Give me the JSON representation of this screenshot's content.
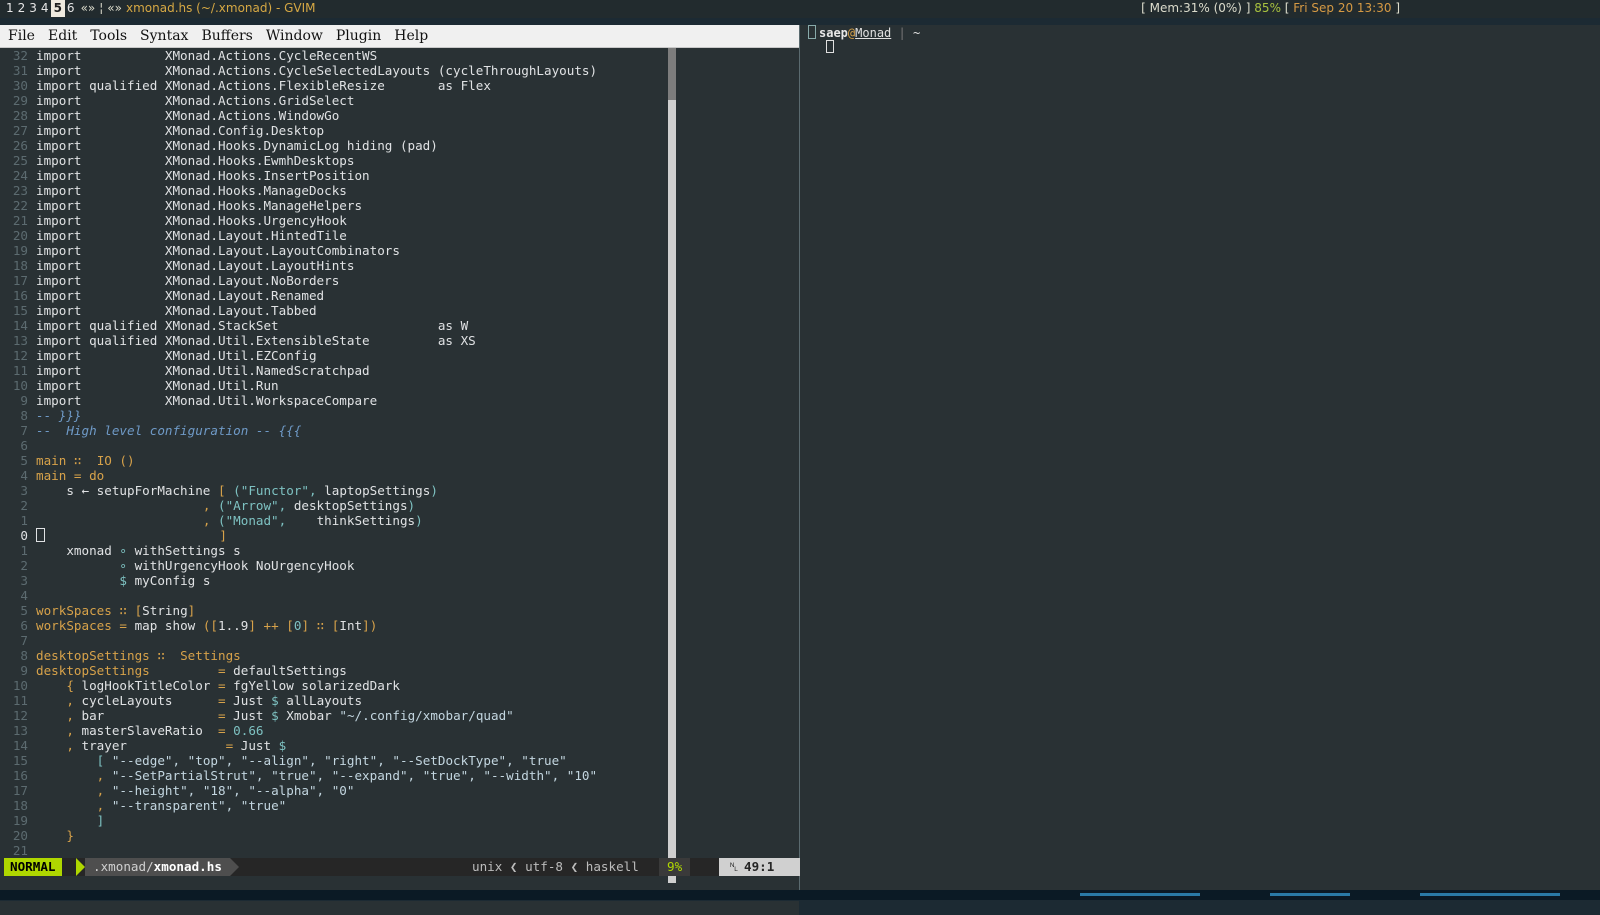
{
  "topbar": {
    "workspaces": [
      {
        "label": "1",
        "current": false
      },
      {
        "label": "2",
        "current": false
      },
      {
        "label": "3",
        "current": false
      },
      {
        "label": "4",
        "current": false
      },
      {
        "label": "5",
        "current": true
      },
      {
        "label": "6",
        "current": false
      }
    ],
    "layout_marker": "«»",
    "separator": "¦",
    "layout_marker2": "«»",
    "window_title": "xmonad.hs (~/.xmonad) - GVIM",
    "mem_open": "[ Mem:",
    "mem_value": "31% (0%)",
    "mem_close": " ] ",
    "battery": "85%",
    "date_open": " [ ",
    "date": "Fri Sep 20 13:30",
    "date_close": " ]"
  },
  "menubar": [
    "File",
    "Edit",
    "Tools",
    "Syntax",
    "Buffers",
    "Window",
    "Plugin",
    "Help"
  ],
  "editor": {
    "lines": [
      {
        "n": "32",
        "t": [
          [
            "kw",
            "import           XMonad.Actions.CycleRecentWS"
          ]
        ]
      },
      {
        "n": "31",
        "t": [
          [
            "kw",
            "import           XMonad.Actions.CycleSelectedLayouts (cycleThroughLayouts)"
          ]
        ]
      },
      {
        "n": "30",
        "t": [
          [
            "kw",
            "import qualified XMonad.Actions.FlexibleResize       as Flex"
          ]
        ]
      },
      {
        "n": "29",
        "t": [
          [
            "kw",
            "import           XMonad.Actions.GridSelect"
          ]
        ]
      },
      {
        "n": "28",
        "t": [
          [
            "kw",
            "import           XMonad.Actions.WindowGo"
          ]
        ]
      },
      {
        "n": "27",
        "t": [
          [
            "kw",
            "import           XMonad.Config.Desktop"
          ]
        ]
      },
      {
        "n": "26",
        "t": [
          [
            "kw",
            "import           XMonad.Hooks.DynamicLog hiding (pad)"
          ]
        ]
      },
      {
        "n": "25",
        "t": [
          [
            "kw",
            "import           XMonad.Hooks.EwmhDesktops"
          ]
        ]
      },
      {
        "n": "24",
        "t": [
          [
            "kw",
            "import           XMonad.Hooks.InsertPosition"
          ]
        ]
      },
      {
        "n": "23",
        "t": [
          [
            "kw",
            "import           XMonad.Hooks.ManageDocks"
          ]
        ]
      },
      {
        "n": "22",
        "t": [
          [
            "kw",
            "import           XMonad.Hooks.ManageHelpers"
          ]
        ]
      },
      {
        "n": "21",
        "t": [
          [
            "kw",
            "import           XMonad.Hooks.UrgencyHook"
          ]
        ]
      },
      {
        "n": "20",
        "t": [
          [
            "kw",
            "import           XMonad.Layout.HintedTile"
          ]
        ]
      },
      {
        "n": "19",
        "t": [
          [
            "kw",
            "import           XMonad.Layout.LayoutCombinators"
          ]
        ]
      },
      {
        "n": "18",
        "t": [
          [
            "kw",
            "import           XMonad.Layout.LayoutHints"
          ]
        ]
      },
      {
        "n": "17",
        "t": [
          [
            "kw",
            "import           XMonad.Layout.NoBorders"
          ]
        ]
      },
      {
        "n": "16",
        "t": [
          [
            "kw",
            "import           XMonad.Layout.Renamed"
          ]
        ]
      },
      {
        "n": "15",
        "t": [
          [
            "kw",
            "import           XMonad.Layout.Tabbed"
          ]
        ]
      },
      {
        "n": "14",
        "t": [
          [
            "kw",
            "import qualified XMonad.StackSet                     as W"
          ]
        ]
      },
      {
        "n": "13",
        "t": [
          [
            "kw",
            "import qualified XMonad.Util.ExtensibleState         as XS"
          ]
        ]
      },
      {
        "n": "12",
        "t": [
          [
            "kw",
            "import           XMonad.Util.EZConfig"
          ]
        ]
      },
      {
        "n": "11",
        "t": [
          [
            "kw",
            "import           XMonad.Util.NamedScratchpad"
          ]
        ]
      },
      {
        "n": "10",
        "t": [
          [
            "kw",
            "import           XMonad.Util.Run"
          ]
        ]
      },
      {
        "n": "9",
        "t": [
          [
            "kw",
            "import           XMonad.Util.WorkspaceCompare"
          ]
        ]
      },
      {
        "n": "8",
        "t": [
          [
            "cm",
            "-- }}}"
          ]
        ]
      },
      {
        "n": "7",
        "t": [
          [
            "cm",
            "--  High level configuration -- {{{"
          ]
        ]
      },
      {
        "n": "6",
        "t": []
      },
      {
        "n": "5",
        "t": [
          [
            "fn",
            "main"
          ],
          [
            "op",
            " ∷  "
          ],
          [
            "ty",
            "IO ()"
          ]
        ]
      },
      {
        "n": "4",
        "t": [
          [
            "fn",
            "main"
          ],
          [
            "op",
            " = "
          ],
          [
            "fn",
            "do"
          ]
        ]
      },
      {
        "n": "3",
        "t": [
          [
            "kw",
            "    s ← setupForMachine "
          ],
          [
            "op",
            "[ "
          ],
          [
            "tl",
            "(\"Functor\", "
          ],
          [
            "kw",
            "laptopSettings"
          ],
          [
            "tl",
            ")"
          ]
        ]
      },
      {
        "n": "2",
        "t": [
          [
            "kw",
            "                      "
          ],
          [
            "op",
            ", "
          ],
          [
            "tl",
            "(\"Arrow\", "
          ],
          [
            "kw",
            "desktopSettings"
          ],
          [
            "tl",
            ")"
          ]
        ]
      },
      {
        "n": "1",
        "t": [
          [
            "kw",
            "                      "
          ],
          [
            "op",
            ", "
          ],
          [
            "tl",
            "(\"Monad\",    "
          ],
          [
            "kw",
            "thinkSettings"
          ],
          [
            "tl",
            ")"
          ]
        ]
      },
      {
        "n": "0",
        "cur": true,
        "t": [
          [
            "cursor",
            ""
          ],
          [
            "kw",
            "                       "
          ],
          [
            "op",
            "]"
          ]
        ]
      },
      {
        "n": "1",
        "t": [
          [
            "kw",
            "    xmonad "
          ],
          [
            "tl",
            "∘"
          ],
          [
            "kw",
            " withSettings s"
          ]
        ]
      },
      {
        "n": "2",
        "t": [
          [
            "kw",
            "           "
          ],
          [
            "tl",
            "∘"
          ],
          [
            "kw",
            " withUrgencyHook NoUrgencyHook"
          ]
        ]
      },
      {
        "n": "3",
        "t": [
          [
            "kw",
            "           "
          ],
          [
            "tl",
            "$"
          ],
          [
            "kw",
            " myConfig s"
          ]
        ]
      },
      {
        "n": "4",
        "t": []
      },
      {
        "n": "5",
        "t": [
          [
            "fn",
            "workSpaces"
          ],
          [
            "op",
            " ∷ "
          ],
          [
            "ty",
            "["
          ],
          [
            "kw",
            "String"
          ],
          [
            "ty",
            "]"
          ]
        ]
      },
      {
        "n": "6",
        "t": [
          [
            "fn",
            "workSpaces"
          ],
          [
            "op",
            " = "
          ],
          [
            "kw",
            "map show "
          ],
          [
            "ty",
            "(["
          ],
          [
            "kw",
            "1..9"
          ],
          [
            "ty",
            "] "
          ],
          [
            "op",
            "++ "
          ],
          [
            "ty",
            "["
          ],
          [
            "nu",
            "0"
          ],
          [
            "ty",
            "] "
          ],
          [
            "op",
            "∷ "
          ],
          [
            "ty",
            "["
          ],
          [
            "kw",
            "Int"
          ],
          [
            "ty",
            "])"
          ]
        ]
      },
      {
        "n": "7",
        "t": []
      },
      {
        "n": "8",
        "t": [
          [
            "fn",
            "desktopSettings"
          ],
          [
            "op",
            " ∷  "
          ],
          [
            "ty",
            "Settings"
          ]
        ]
      },
      {
        "n": "9",
        "t": [
          [
            "fn",
            "desktopSettings"
          ],
          [
            "kw",
            "         "
          ],
          [
            "op",
            "= "
          ],
          [
            "kw",
            "defaultSettings"
          ]
        ]
      },
      {
        "n": "10",
        "t": [
          [
            "kw",
            "    "
          ],
          [
            "op",
            "{ "
          ],
          [
            "kw",
            "logHookTitleColor "
          ],
          [
            "op",
            "= "
          ],
          [
            "kw",
            "fgYellow solarizedDark"
          ]
        ]
      },
      {
        "n": "11",
        "t": [
          [
            "kw",
            "    "
          ],
          [
            "op",
            ", "
          ],
          [
            "kw",
            "cycleLayouts      "
          ],
          [
            "op",
            "= "
          ],
          [
            "kw",
            "Just "
          ],
          [
            "tl",
            "$"
          ],
          [
            "kw",
            " allLayouts"
          ]
        ]
      },
      {
        "n": "12",
        "t": [
          [
            "kw",
            "    "
          ],
          [
            "op",
            ", "
          ],
          [
            "kw",
            "bar               "
          ],
          [
            "op",
            "= "
          ],
          [
            "kw",
            "Just "
          ],
          [
            "tl",
            "$"
          ],
          [
            "kw",
            " Xmobar "
          ],
          [
            "st",
            "\"~/.config/xmobar/quad\""
          ]
        ]
      },
      {
        "n": "13",
        "t": [
          [
            "kw",
            "    "
          ],
          [
            "op",
            ", "
          ],
          [
            "kw",
            "masterSlaveRatio  "
          ],
          [
            "op",
            "= "
          ],
          [
            "nu",
            "0.66"
          ]
        ]
      },
      {
        "n": "14",
        "t": [
          [
            "kw",
            "    "
          ],
          [
            "op",
            ", "
          ],
          [
            "kw",
            "trayer             "
          ],
          [
            "op",
            "= "
          ],
          [
            "kw",
            "Just "
          ],
          [
            "tl",
            "$"
          ]
        ]
      },
      {
        "n": "15",
        "t": [
          [
            "kw",
            "        "
          ],
          [
            "tl",
            "[ "
          ],
          [
            "st",
            "\"--edge\", \"top\", \"--align\", \"right\", \"--SetDockType\", \"true\""
          ]
        ]
      },
      {
        "n": "16",
        "t": [
          [
            "kw",
            "        "
          ],
          [
            "op",
            ", "
          ],
          [
            "st",
            "\"--SetPartialStrut\", \"true\", \"--expand\", \"true\", \"--width\", \"10\""
          ]
        ]
      },
      {
        "n": "17",
        "t": [
          [
            "kw",
            "        "
          ],
          [
            "op",
            ", "
          ],
          [
            "st",
            "\"--height\", \"18\", \"--alpha\", \"0\""
          ]
        ]
      },
      {
        "n": "18",
        "t": [
          [
            "kw",
            "        "
          ],
          [
            "op",
            ", "
          ],
          [
            "st",
            "\"--transparent\", \"true\""
          ]
        ]
      },
      {
        "n": "19",
        "t": [
          [
            "kw",
            "        "
          ],
          [
            "tl",
            "]"
          ]
        ]
      },
      {
        "n": "20",
        "t": [
          [
            "kw",
            "    "
          ],
          [
            "op",
            "}"
          ]
        ]
      },
      {
        "n": "21",
        "t": []
      }
    ]
  },
  "statusline": {
    "mode": "NORMAL",
    "file_dir": ".xmonad/",
    "file_name": "xmonad.hs",
    "format": "unix",
    "encoding": "utf-8",
    "filetype": "haskell",
    "percent": "9%",
    "line_icon": "␤",
    "position": "49:1"
  },
  "terminal": {
    "user": "saep",
    "at": "@",
    "host": "Monad",
    "pipe": " | ",
    "path": "~"
  },
  "colors": {
    "mode_bg": "#afd700",
    "accent": "#d7a24a",
    "background": "#293134"
  }
}
